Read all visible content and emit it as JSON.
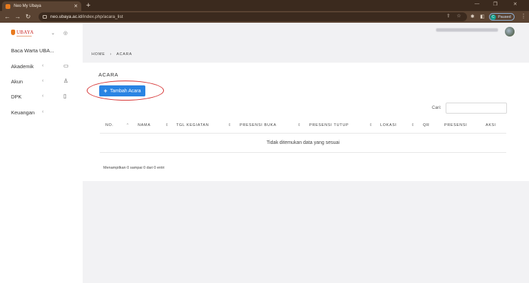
{
  "browser": {
    "tab_title": "Neo My Ubaya",
    "tab_close": "✕",
    "new_tab": "+",
    "url_host": "neo.ubaya.ac.id",
    "url_path": "/index.php/acara_list",
    "profile_initial": "C",
    "profile_status": "Paused"
  },
  "sidebar": {
    "logo_text": "UBAYA",
    "items": [
      {
        "label": "Baca Warta UBA..."
      },
      {
        "label": "Akademik",
        "arrow": "‹",
        "icon": "book-icon"
      },
      {
        "label": "Akun",
        "arrow": "‹",
        "icon": "user-icon"
      },
      {
        "label": "DPK",
        "arrow": "‹",
        "icon": "badge-icon"
      },
      {
        "label": "Keuangan",
        "arrow": "‹"
      }
    ]
  },
  "breadcrumb": {
    "home": "HOME",
    "sep": "›",
    "current": "ACARA"
  },
  "page": {
    "title": "ACARA",
    "add_button": "Tambah Acara",
    "search_label": "Cari:",
    "search_value": "",
    "columns": [
      "NO.",
      "NAMA",
      "TGL KEGIATAN",
      "PRESENSI BUKA",
      "PRESENSI TUTUP",
      "LOKASI",
      "QR",
      "PRESENSI",
      "AKSI"
    ],
    "empty_text": "Tidak ditemukan data yang sesuai",
    "info_text": "Menampilkan 0 sampai 0 dari 0 entri"
  },
  "colors": {
    "primary": "#2a84e3",
    "annotation": "#d42a2a",
    "chrome": "#5a4332"
  }
}
